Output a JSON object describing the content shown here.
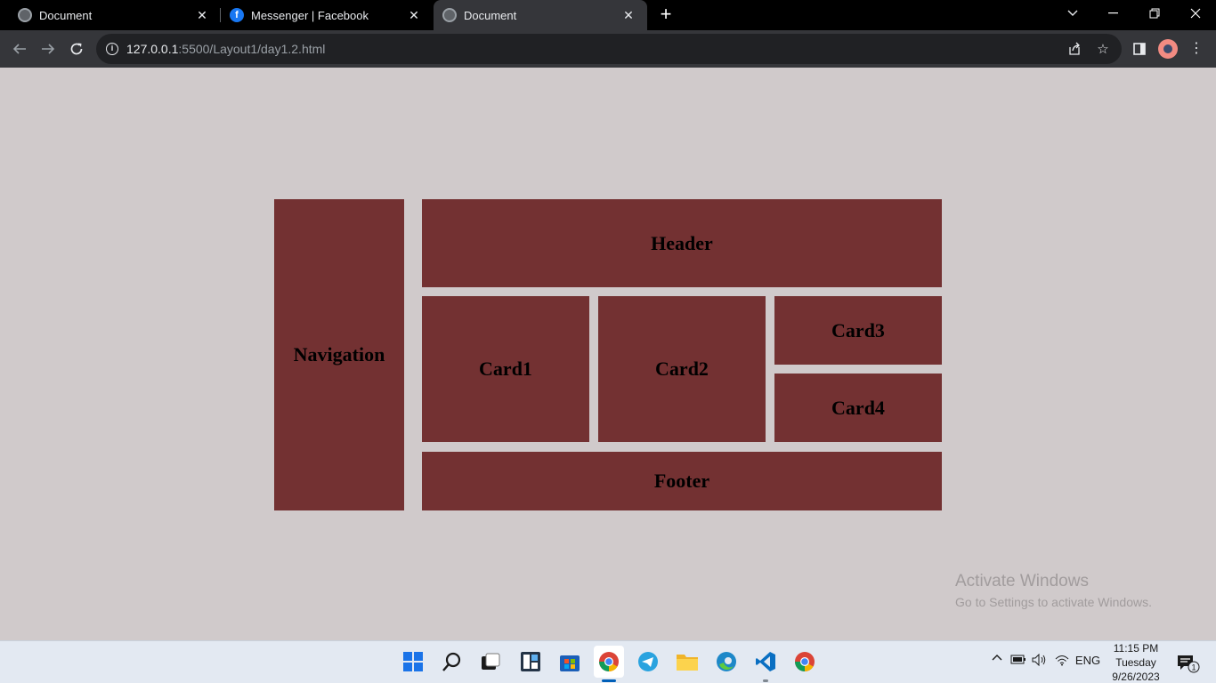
{
  "browser": {
    "tabs": [
      {
        "title": "Document",
        "favicon": "globe-icon",
        "active": false
      },
      {
        "title": "Messenger | Facebook",
        "favicon": "facebook-icon",
        "active": false
      },
      {
        "title": "Document",
        "favicon": "globe-icon",
        "active": true
      }
    ],
    "url_host": "127.0.0.1",
    "url_rest": ":5500/Layout1/day1.2.html"
  },
  "page": {
    "background": "#d0cacb",
    "box_color": "#733132",
    "navigation": "Navigation",
    "header": "Header",
    "card1": "Card1",
    "card2": "Card2",
    "card3": "Card3",
    "card4": "Card4",
    "footer": "Footer"
  },
  "watermark": {
    "line1": "Activate Windows",
    "line2": "Go to Settings to activate Windows."
  },
  "taskbar": {
    "apps": [
      "start-icon",
      "search-icon",
      "task-view-icon",
      "widgets-icon",
      "store-icon",
      "chrome-icon",
      "telegram-icon",
      "file-explorer-icon",
      "edge-icon",
      "vscode-icon",
      "chrome-icon"
    ],
    "language": "ENG",
    "time": "11:15 PM",
    "day": "Tuesday",
    "date": "9/26/2023",
    "notification_count": "1"
  }
}
